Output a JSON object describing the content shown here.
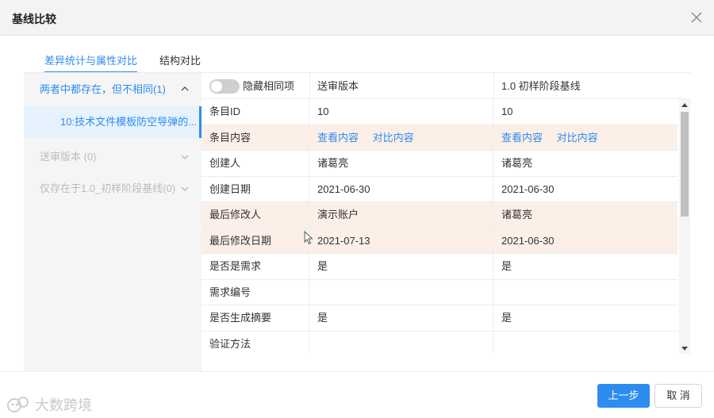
{
  "dialog": {
    "title": "基线比较"
  },
  "tabs": [
    {
      "label": "差异统计与属性对比",
      "active": true
    },
    {
      "label": "结构对比",
      "active": false
    }
  ],
  "left_panel": {
    "groups": [
      {
        "label": "两者中都存在，但不相同(1)",
        "expanded": true,
        "children": [
          "10:技术文件模板防空导弹的..."
        ]
      },
      {
        "label": "送审版本 (0)",
        "expanded": false
      },
      {
        "label": "仅存在于1.0_初样阶段基线(0)",
        "expanded": false
      }
    ]
  },
  "table": {
    "hide_same_label": "隐藏相同项",
    "hide_same_on": false,
    "columns": [
      "送审版本",
      "1.0 初样阶段基线"
    ],
    "rows": [
      {
        "attr": "条目ID",
        "v1": "10",
        "v2": "10",
        "diff": false
      },
      {
        "attr": "条目内容",
        "v1_links": [
          "查看内容",
          "对比内容"
        ],
        "v2_links": [
          "查看内容",
          "对比内容"
        ],
        "diff": true
      },
      {
        "attr": "创建人",
        "v1": "诸葛亮",
        "v2": "诸葛亮",
        "diff": false
      },
      {
        "attr": "创建日期",
        "v1": "2021-06-30",
        "v2": "2021-06-30",
        "diff": false
      },
      {
        "attr": "最后修改人",
        "v1": "演示账户",
        "v2": "诸葛亮",
        "diff": true
      },
      {
        "attr": "最后修改日期",
        "v1": "2021-07-13",
        "v2": "2021-06-30",
        "diff": true
      },
      {
        "attr": "是否是需求",
        "v1": "是",
        "v2": "是",
        "diff": false
      },
      {
        "attr": "需求编号",
        "v1": "",
        "v2": "",
        "diff": false
      },
      {
        "attr": "是否生成摘要",
        "v1": "是",
        "v2": "是",
        "diff": false
      },
      {
        "attr": "验证方法",
        "v1": "",
        "v2": "",
        "diff": false
      }
    ]
  },
  "footer": {
    "prev_label": "上一步",
    "cancel_label": "取 消",
    "watermark": "大数跨境"
  },
  "colors": {
    "accent": "#2d8cf0",
    "diff_row": "#fcefe7"
  }
}
